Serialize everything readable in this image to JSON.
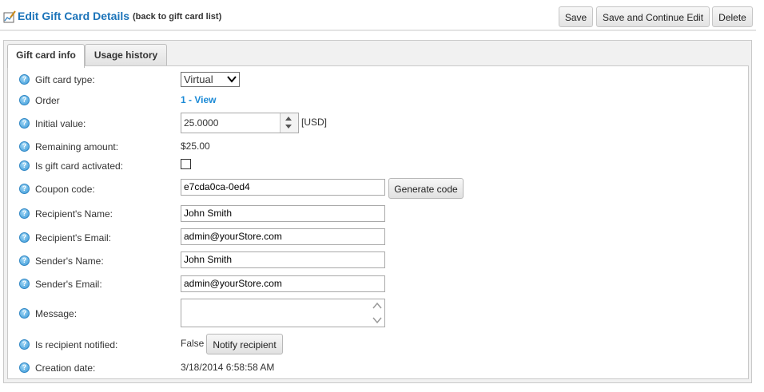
{
  "header": {
    "title": "Edit Gift Card Details",
    "back_link": "(back to gift card list)",
    "save_label": "Save",
    "save_continue_label": "Save and Continue Edit",
    "delete_label": "Delete"
  },
  "tabs": [
    {
      "label": "Gift card info",
      "active": true
    },
    {
      "label": "Usage history",
      "active": false
    }
  ],
  "form": {
    "gift_card_type": {
      "label": "Gift card type:",
      "value": "Virtual"
    },
    "order": {
      "label": "Order",
      "value": "1 - View"
    },
    "initial_value": {
      "label": "Initial value:",
      "value": "25.0000",
      "currency": "[USD]"
    },
    "remaining_amount": {
      "label": "Remaining amount:",
      "value": "$25.00"
    },
    "activated": {
      "label": "Is gift card activated:",
      "checked": false
    },
    "coupon_code": {
      "label": "Coupon code:",
      "value": "e7cda0ca-0ed4",
      "button": "Generate code"
    },
    "recipient_name": {
      "label": "Recipient's Name:",
      "value": "John Smith"
    },
    "recipient_email": {
      "label": "Recipient's Email:",
      "value": "admin@yourStore.com"
    },
    "sender_name": {
      "label": "Sender's Name:",
      "value": "John Smith"
    },
    "sender_email": {
      "label": "Sender's Email:",
      "value": "admin@yourStore.com"
    },
    "message": {
      "label": "Message:",
      "value": ""
    },
    "recipient_notified": {
      "label": "Is recipient notified:",
      "value": "False",
      "button": "Notify recipient"
    },
    "creation_date": {
      "label": "Creation date:",
      "value": "3/18/2014 6:58:58 AM"
    }
  },
  "colors": {
    "accent": "#1b73b9",
    "link": "#1b8ad6",
    "help_icon": "#3a9ad9"
  },
  "icons": {
    "title": "edit-chart-icon",
    "help": "help-icon"
  }
}
